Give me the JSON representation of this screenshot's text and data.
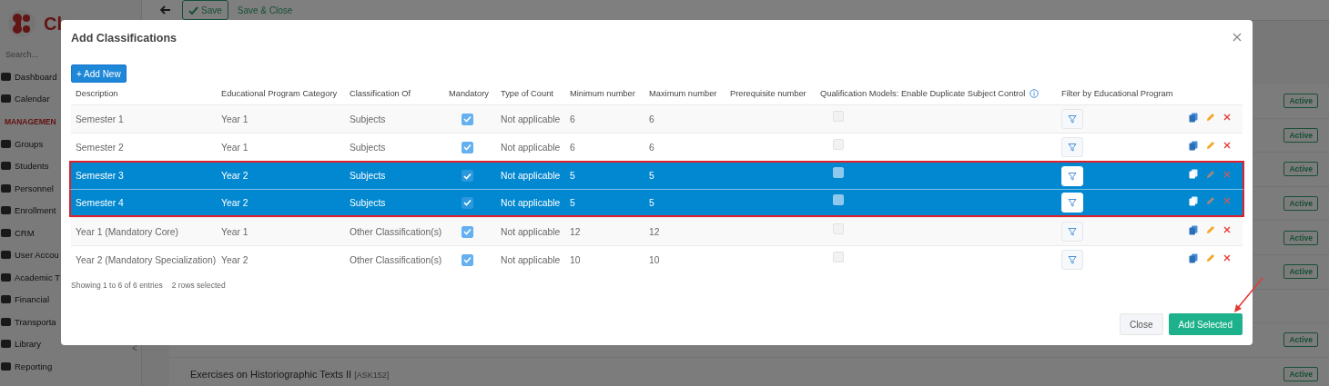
{
  "sidebar": {
    "logo_text": "Cl",
    "search": {
      "placeholder": "Search..."
    },
    "collapse": "<",
    "items": [
      {
        "label": "Dashboard",
        "kind": "item"
      },
      {
        "label": "Calendar",
        "kind": "item"
      },
      {
        "label": "MANAGEMEN",
        "kind": "section"
      },
      {
        "label": "Groups",
        "kind": "item"
      },
      {
        "label": "Students",
        "kind": "item"
      },
      {
        "label": "Personnel",
        "kind": "item"
      },
      {
        "label": "Enrollment",
        "kind": "item"
      },
      {
        "label": "CRM",
        "kind": "item"
      },
      {
        "label": "User Accou",
        "kind": "item"
      },
      {
        "label": "Academic T",
        "kind": "item"
      },
      {
        "label": "Financial",
        "kind": "item"
      },
      {
        "label": "Transporta",
        "kind": "item"
      },
      {
        "label": "Library",
        "kind": "item"
      },
      {
        "label": "Reporting",
        "kind": "item"
      }
    ]
  },
  "toolbar": {
    "save": "Save",
    "save_close": "Save & Close"
  },
  "background_rows": [
    {
      "kind": "item",
      "status": "Active"
    },
    {
      "kind": "item",
      "status": "Active"
    },
    {
      "kind": "item",
      "status": "Active"
    },
    {
      "kind": "item",
      "status": "Active"
    },
    {
      "kind": "item",
      "status": "Active"
    },
    {
      "kind": "item",
      "status": "Active"
    },
    {
      "kind": "blank"
    },
    {
      "kind": "item",
      "status": "Active"
    },
    {
      "kind": "item",
      "title": "Exercises on Historiographic Texts II",
      "code": "[ASK152]",
      "status": "Active"
    }
  ],
  "modal": {
    "title": "Add Classifications",
    "add_button": "+ Add New",
    "columns": [
      "Description",
      "Educational Program Category",
      "Classification Of",
      "Mandatory",
      "Type of Count",
      "Minimum number",
      "Maximum number",
      "Prerequisite number",
      "Qualification Models: Enable Duplicate Subject Control",
      "Filter by Educational Program"
    ],
    "rows": [
      {
        "description": "Semester 1",
        "category": "Year 1",
        "classification_of": "Subjects",
        "mandatory": true,
        "type_of_count": "Not applicable",
        "minimum": "6",
        "maximum": "6",
        "duplicate_control": false,
        "selected": false
      },
      {
        "description": "Semester 2",
        "category": "Year 1",
        "classification_of": "Subjects",
        "mandatory": true,
        "type_of_count": "Not applicable",
        "minimum": "6",
        "maximum": "6",
        "duplicate_control": false,
        "selected": false
      },
      {
        "description": "Semester 3",
        "category": "Year 2",
        "classification_of": "Subjects",
        "mandatory": true,
        "type_of_count": "Not applicable",
        "minimum": "5",
        "maximum": "5",
        "duplicate_control": false,
        "selected": true
      },
      {
        "description": "Semester 4",
        "category": "Year 2",
        "classification_of": "Subjects",
        "mandatory": true,
        "type_of_count": "Not applicable",
        "minimum": "5",
        "maximum": "5",
        "duplicate_control": false,
        "selected": true
      },
      {
        "description": "Year 1 (Mandatory Core)",
        "category": "Year 1",
        "classification_of": "Other Classification(s)",
        "mandatory": true,
        "type_of_count": "Not applicable",
        "minimum": "12",
        "maximum": "12",
        "duplicate_control": false,
        "selected": false
      },
      {
        "description": "Year 2 (Mandatory Specialization)",
        "category": "Year 2",
        "classification_of": "Other Classification(s)",
        "mandatory": true,
        "type_of_count": "Not applicable",
        "minimum": "10",
        "maximum": "10",
        "duplicate_control": false,
        "selected": false
      }
    ],
    "info": "Showing 1 to 6 of 6 entries",
    "selection_info": "2 rows selected",
    "close_button": "Close",
    "add_selected_button": "Add Selected"
  }
}
